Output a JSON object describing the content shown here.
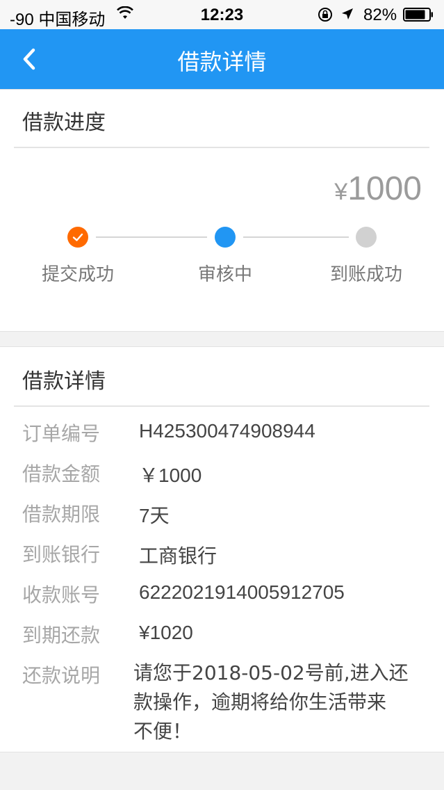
{
  "status_bar": {
    "carrier": "-90 中国移动",
    "time": "12:23",
    "battery": "82%",
    "wifi_icon": "wifi-icon",
    "lock_icon": "orientation-lock-icon",
    "location_icon": "location-arrow-icon",
    "battery_icon": "battery-icon"
  },
  "nav": {
    "title": "借款详情",
    "back_icon": "chevron-left-icon",
    "color": "#2196f3"
  },
  "progress": {
    "section_title": "借款进度",
    "currency": "¥",
    "amount": "1000",
    "steps": [
      {
        "label": "提交成功",
        "state": "done",
        "color": "#ff6a00",
        "icon": "check-icon"
      },
      {
        "label": "审核中",
        "state": "current",
        "color": "#2196f3"
      },
      {
        "label": "到账成功",
        "state": "pending",
        "color": "#d1d1d1"
      }
    ]
  },
  "detail": {
    "section_title": "借款详情",
    "rows": [
      {
        "label": "订单编号",
        "value": "H425300474908944"
      },
      {
        "label": "借款金额",
        "value": "￥1000"
      },
      {
        "label": "借款期限",
        "value": "7天"
      },
      {
        "label": "到账银行",
        "value": "工商银行"
      },
      {
        "label": "收款账号",
        "value": "6222021914005912705"
      },
      {
        "label": "到期还款",
        "value": "¥1020"
      }
    ],
    "note": {
      "label": "还款说明",
      "lines": [
        "请您于2018-05-02号前,进入还",
        "款操作，逾期将给你生活带来",
        "不便！"
      ]
    }
  }
}
